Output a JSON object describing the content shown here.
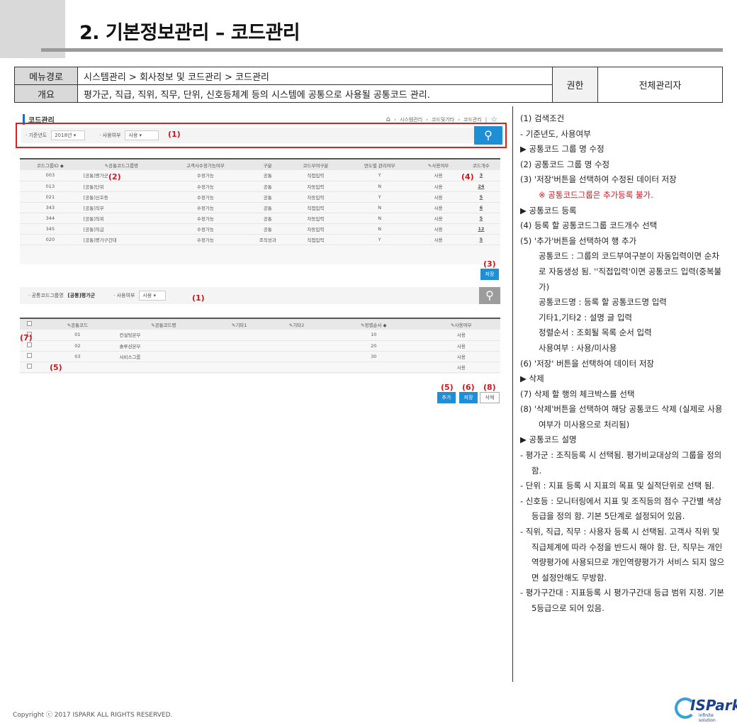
{
  "page_title": "2. 기본정보관리 – 코드관리",
  "info": {
    "menu_label": "메뉴경로",
    "menu_value": "시스템관리 > 회사정보 및 코드관리 > 코드관리",
    "overview_label": "개요",
    "overview_value": "평가군, 직급, 직위, 직무, 단위, 신호등체계 등의 시스템에 공통으로 사용될 공통코드 관리.",
    "perm_label": "권한",
    "perm_value": "전체관리자"
  },
  "screenshot": {
    "header": "코드관리",
    "breadcrumb": [
      "시스템관리",
      "코드및기타",
      "코드관리"
    ],
    "search1": {
      "year_label": "· 기준년도",
      "year_value": "2018년",
      "use_label": "· 사용여부",
      "use_value": "사용"
    },
    "grid1": {
      "headers": [
        "코드그룹ID ◆",
        "✎공통코드그룹명",
        "고객사수정가능여부",
        "구분",
        "코드부여구분",
        "연도별 관리여부",
        "✎사용여부",
        "코드개수"
      ],
      "rows": [
        [
          "003",
          "[공통]평가군",
          "수정가능",
          "공통",
          "직접입력",
          "Y",
          "사용",
          "3"
        ],
        [
          "013",
          "[공통]단위",
          "수정가능",
          "공통",
          "자동입력",
          "N",
          "사용",
          "24"
        ],
        [
          "021",
          "[공통]신호등",
          "수정가능",
          "공통",
          "자동입력",
          "Y",
          "사용",
          "5"
        ],
        [
          "343",
          "[공통]직무",
          "수정가능",
          "공통",
          "직접입력",
          "N",
          "사용",
          "6"
        ],
        [
          "344",
          "[공통]직위",
          "수정가능",
          "공통",
          "자동입력",
          "N",
          "사용",
          "5"
        ],
        [
          "345",
          "[공통]직급",
          "수정가능",
          "공통",
          "자동입력",
          "N",
          "사용",
          "12"
        ],
        [
          "020",
          "[공통]평가구간대",
          "수정가능",
          "조직성과",
          "직접입력",
          "Y",
          "사용",
          "5"
        ]
      ]
    },
    "save_button": "저장",
    "search2": {
      "group_label": "· 공통코드그룹명",
      "group_value": "[공통]평가군",
      "use_label": "· 사용여부",
      "use_value": "사용"
    },
    "grid2": {
      "headers": [
        "",
        "✎공통코드",
        "✎공통코드명",
        "✎기타1",
        "✎기타2",
        "✎정렬순서 ◆",
        "✎사용여부"
      ],
      "rows": [
        [
          "",
          "01",
          "컨설팅본부",
          "",
          "",
          "10",
          "사용"
        ],
        [
          "",
          "02",
          "솔루션본부",
          "",
          "",
          "20",
          "사용"
        ],
        [
          "",
          "03",
          "서비스그룹",
          "",
          "",
          "30",
          "사용"
        ],
        [
          "",
          "",
          "",
          "",
          "",
          "",
          "사용"
        ]
      ]
    },
    "add_button": "추가",
    "save_button2": "저장",
    "delete_button": "삭제",
    "callouts": {
      "c1a": "(1)",
      "c2": "(2)",
      "c4": "(4)",
      "c3": "(3)",
      "c1b": "(1)",
      "c7": "(7)",
      "c5a": "(5)",
      "c5b": "(5)",
      "c6": "(6)",
      "c8": "(8)"
    }
  },
  "notes": [
    {
      "cls": "hang",
      "text": "(1)  검색조건"
    },
    {
      "cls": "",
      "text": "  - 기준년도, 사용여부"
    },
    {
      "cls": "",
      "text": "▶ 공통코드 그룹 명 수정"
    },
    {
      "cls": "hang",
      "text": "(2)  공통코드 그룹 명 수정"
    },
    {
      "cls": "hang",
      "text": "(3)  '저장'버튼을 선택하여 수정된 데이터 저장"
    },
    {
      "cls": "warn",
      "text": "※ 공통코드그룹은 추가등록 불가."
    },
    {
      "cls": "",
      "text": "▶ 공통코드 등록"
    },
    {
      "cls": "hang",
      "text": "(4)  등록 할 공통코드그룹 코드개수 선택"
    },
    {
      "cls": "hang",
      "text": "(5)  '추가'버튼을 선택하여 행 추가"
    },
    {
      "cls": "ind",
      "text": "공통코드 : 그룹의 코드부여구분이 자동입력이면 순차로 자동생성 됨. ''직접입력'이면 공통코드 입력(중복불가)"
    },
    {
      "cls": "ind",
      "text": "공통코드명 : 등록 할 공통코드명 입력"
    },
    {
      "cls": "ind",
      "text": "기타1,기타2 : 설명 글 입력"
    },
    {
      "cls": "ind",
      "text": "정렬순서 : 조회될 목록 순서 입력"
    },
    {
      "cls": "ind",
      "text": "사용여부 : 사용/미사용"
    },
    {
      "cls": "hang",
      "text": "(6)  '저장' 버튼을 선택하여 데이터 저장"
    },
    {
      "cls": "",
      "text": "▶ 삭제"
    },
    {
      "cls": "hang",
      "text": "(7)  삭제 할 행의 체크박스를 선택"
    },
    {
      "cls": "hang",
      "text": "(8)  '삭제'버튼을 선택하여 해당 공통코드 삭제 (실제로 사용여부가 미사용으로 처리됨)"
    },
    {
      "cls": "",
      "text": "▶ 공통코드 설명"
    },
    {
      "cls": "dash",
      "text": "- 평가군 : 조직등록 시 선택됨. 평가비교대상의 그룹을 정의함."
    },
    {
      "cls": "dash",
      "text": "- 단위 : 지표 등록 시 지표의 목표 및 실적단위로 선택 됨."
    },
    {
      "cls": "dash",
      "text": "- 신호등 : 모니터링에서 지표 및 조직등의 점수 구간별 색상등급을 정의 함. 기본 5단계로 설정되어 있음."
    },
    {
      "cls": "dash",
      "text": "- 직위, 직급, 직무 : 사용자 등록 시 선택됨. 고객사 직위 및 직급체계에 따라 수정을 반드시 해야 함. 단, 직무는 개인역량평가에 사용되므로 개인역량평가가 서비스 되지 않으면 설정안해도 무방함."
    },
    {
      "cls": "dash",
      "text": "- 평가구간대 : 지표등록 시 평가구간대  등급 범위 지정. 기본 5등급으로 되어 있음."
    }
  ],
  "footer": "Copyright ⓒ 2017 ISPARK ALL RIGHTS RESERVED.",
  "logo": {
    "text": "ISPark",
    "sub": "infinite solution"
  }
}
